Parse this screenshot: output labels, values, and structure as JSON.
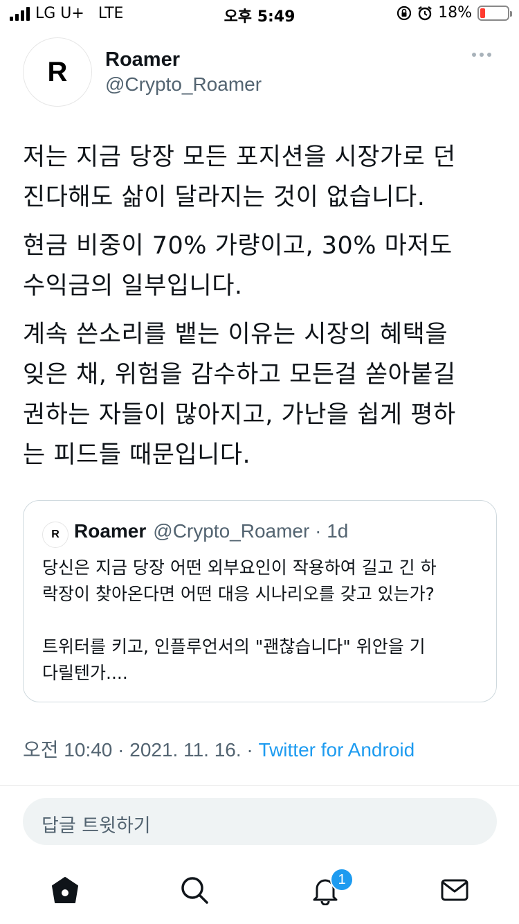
{
  "status_bar": {
    "carrier": "LG U+",
    "network": "LTE",
    "time": "오후 5:49",
    "battery_percent": "18%",
    "battery_level": 0.18,
    "battery_color": "#ff3b30",
    "icons": [
      "signal-icon",
      "rotation-lock-icon",
      "alarm-icon",
      "battery-icon"
    ]
  },
  "tweet": {
    "avatar_letter": "R",
    "display_name": "Roamer",
    "handle": "@Crypto_Roamer",
    "paragraphs": [
      "저는 지금 당장 모든 포지션을 시장가로 던\n진다해도 삶이 달라지는 것이 없습니다.",
      "현금 비중이 70% 가량이고, 30% 마저도\n수익금의 일부입니다.",
      "계속 쓴소리를 뱉는 이유는 시장의 혜택을\n잊은 채, 위험을 감수하고 모든걸 쏟아붙길\n권하는 자들이 많아지고, 가난을 쉽게 평하\n는 피드들 때문입니다."
    ],
    "quote": {
      "avatar_letter": "R",
      "display_name": "Roamer",
      "meta": "@Crypto_Roamer · 1d",
      "paragraphs": [
        "당신은 지금 당장 어떤 외부요인이 작용하여 길고 긴 하\n락장이 찾아온다면 어떤 대응 시나리오를 갖고 있는가?",
        "트위터를 키고, 인플루언서의 \"괜찮습니다\" 위안을 기\n다릴텐가...."
      ]
    },
    "timestamp": "오전 10:40 · 2021. 11. 16. · ",
    "source": "Twitter for Android",
    "accent_color": "#1d9bf0"
  },
  "reply": {
    "placeholder": "답글 트윗하기"
  },
  "nav": {
    "items": [
      "home-icon",
      "search-icon",
      "notifications-icon",
      "messages-icon"
    ],
    "notification_badge": "1"
  }
}
